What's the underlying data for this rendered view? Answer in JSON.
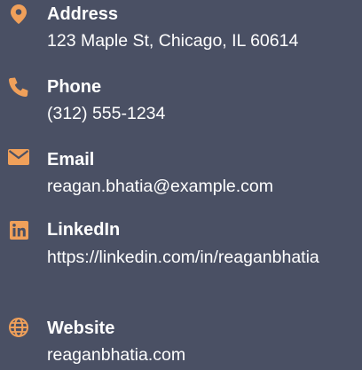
{
  "colors": {
    "background": "#4a5064",
    "accent": "#f0a05a",
    "text": "#ffffff"
  },
  "contacts": [
    {
      "icon": "map-pin-icon",
      "label": "Address",
      "value": "123 Maple St, Chicago, IL 60614"
    },
    {
      "icon": "phone-icon",
      "label": "Phone",
      "value": "(312) 555-1234"
    },
    {
      "icon": "envelope-icon",
      "label": "Email",
      "value": "reagan.bhatia@example.com"
    },
    {
      "icon": "linkedin-icon",
      "label": "LinkedIn",
      "value": "https://linkedin.com/in/reaganbhatia"
    },
    {
      "icon": "globe-icon",
      "label": "Website",
      "value": "reaganbhatia.com"
    }
  ]
}
